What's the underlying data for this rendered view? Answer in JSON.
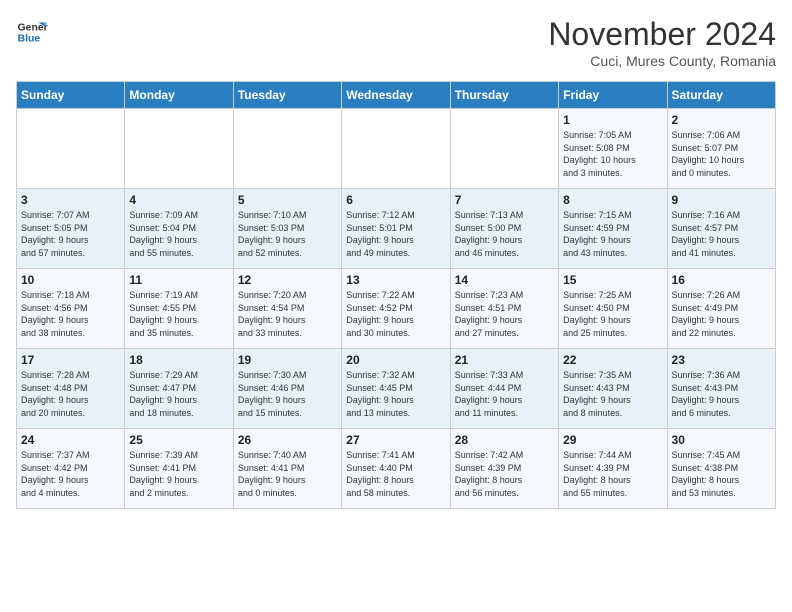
{
  "header": {
    "logo_line1": "General",
    "logo_line2": "Blue",
    "month_title": "November 2024",
    "location": "Cuci, Mures County, Romania"
  },
  "days_of_week": [
    "Sunday",
    "Monday",
    "Tuesday",
    "Wednesday",
    "Thursday",
    "Friday",
    "Saturday"
  ],
  "weeks": [
    [
      {
        "day": "",
        "info": ""
      },
      {
        "day": "",
        "info": ""
      },
      {
        "day": "",
        "info": ""
      },
      {
        "day": "",
        "info": ""
      },
      {
        "day": "",
        "info": ""
      },
      {
        "day": "1",
        "info": "Sunrise: 7:05 AM\nSunset: 5:08 PM\nDaylight: 10 hours\nand 3 minutes."
      },
      {
        "day": "2",
        "info": "Sunrise: 7:06 AM\nSunset: 5:07 PM\nDaylight: 10 hours\nand 0 minutes."
      }
    ],
    [
      {
        "day": "3",
        "info": "Sunrise: 7:07 AM\nSunset: 5:05 PM\nDaylight: 9 hours\nand 57 minutes."
      },
      {
        "day": "4",
        "info": "Sunrise: 7:09 AM\nSunset: 5:04 PM\nDaylight: 9 hours\nand 55 minutes."
      },
      {
        "day": "5",
        "info": "Sunrise: 7:10 AM\nSunset: 5:03 PM\nDaylight: 9 hours\nand 52 minutes."
      },
      {
        "day": "6",
        "info": "Sunrise: 7:12 AM\nSunset: 5:01 PM\nDaylight: 9 hours\nand 49 minutes."
      },
      {
        "day": "7",
        "info": "Sunrise: 7:13 AM\nSunset: 5:00 PM\nDaylight: 9 hours\nand 46 minutes."
      },
      {
        "day": "8",
        "info": "Sunrise: 7:15 AM\nSunset: 4:59 PM\nDaylight: 9 hours\nand 43 minutes."
      },
      {
        "day": "9",
        "info": "Sunrise: 7:16 AM\nSunset: 4:57 PM\nDaylight: 9 hours\nand 41 minutes."
      }
    ],
    [
      {
        "day": "10",
        "info": "Sunrise: 7:18 AM\nSunset: 4:56 PM\nDaylight: 9 hours\nand 38 minutes."
      },
      {
        "day": "11",
        "info": "Sunrise: 7:19 AM\nSunset: 4:55 PM\nDaylight: 9 hours\nand 35 minutes."
      },
      {
        "day": "12",
        "info": "Sunrise: 7:20 AM\nSunset: 4:54 PM\nDaylight: 9 hours\nand 33 minutes."
      },
      {
        "day": "13",
        "info": "Sunrise: 7:22 AM\nSunset: 4:52 PM\nDaylight: 9 hours\nand 30 minutes."
      },
      {
        "day": "14",
        "info": "Sunrise: 7:23 AM\nSunset: 4:51 PM\nDaylight: 9 hours\nand 27 minutes."
      },
      {
        "day": "15",
        "info": "Sunrise: 7:25 AM\nSunset: 4:50 PM\nDaylight: 9 hours\nand 25 minutes."
      },
      {
        "day": "16",
        "info": "Sunrise: 7:26 AM\nSunset: 4:49 PM\nDaylight: 9 hours\nand 22 minutes."
      }
    ],
    [
      {
        "day": "17",
        "info": "Sunrise: 7:28 AM\nSunset: 4:48 PM\nDaylight: 9 hours\nand 20 minutes."
      },
      {
        "day": "18",
        "info": "Sunrise: 7:29 AM\nSunset: 4:47 PM\nDaylight: 9 hours\nand 18 minutes."
      },
      {
        "day": "19",
        "info": "Sunrise: 7:30 AM\nSunset: 4:46 PM\nDaylight: 9 hours\nand 15 minutes."
      },
      {
        "day": "20",
        "info": "Sunrise: 7:32 AM\nSunset: 4:45 PM\nDaylight: 9 hours\nand 13 minutes."
      },
      {
        "day": "21",
        "info": "Sunrise: 7:33 AM\nSunset: 4:44 PM\nDaylight: 9 hours\nand 11 minutes."
      },
      {
        "day": "22",
        "info": "Sunrise: 7:35 AM\nSunset: 4:43 PM\nDaylight: 9 hours\nand 8 minutes."
      },
      {
        "day": "23",
        "info": "Sunrise: 7:36 AM\nSunset: 4:43 PM\nDaylight: 9 hours\nand 6 minutes."
      }
    ],
    [
      {
        "day": "24",
        "info": "Sunrise: 7:37 AM\nSunset: 4:42 PM\nDaylight: 9 hours\nand 4 minutes."
      },
      {
        "day": "25",
        "info": "Sunrise: 7:39 AM\nSunset: 4:41 PM\nDaylight: 9 hours\nand 2 minutes."
      },
      {
        "day": "26",
        "info": "Sunrise: 7:40 AM\nSunset: 4:41 PM\nDaylight: 9 hours\nand 0 minutes."
      },
      {
        "day": "27",
        "info": "Sunrise: 7:41 AM\nSunset: 4:40 PM\nDaylight: 8 hours\nand 58 minutes."
      },
      {
        "day": "28",
        "info": "Sunrise: 7:42 AM\nSunset: 4:39 PM\nDaylight: 8 hours\nand 56 minutes."
      },
      {
        "day": "29",
        "info": "Sunrise: 7:44 AM\nSunset: 4:39 PM\nDaylight: 8 hours\nand 55 minutes."
      },
      {
        "day": "30",
        "info": "Sunrise: 7:45 AM\nSunset: 4:38 PM\nDaylight: 8 hours\nand 53 minutes."
      }
    ]
  ]
}
